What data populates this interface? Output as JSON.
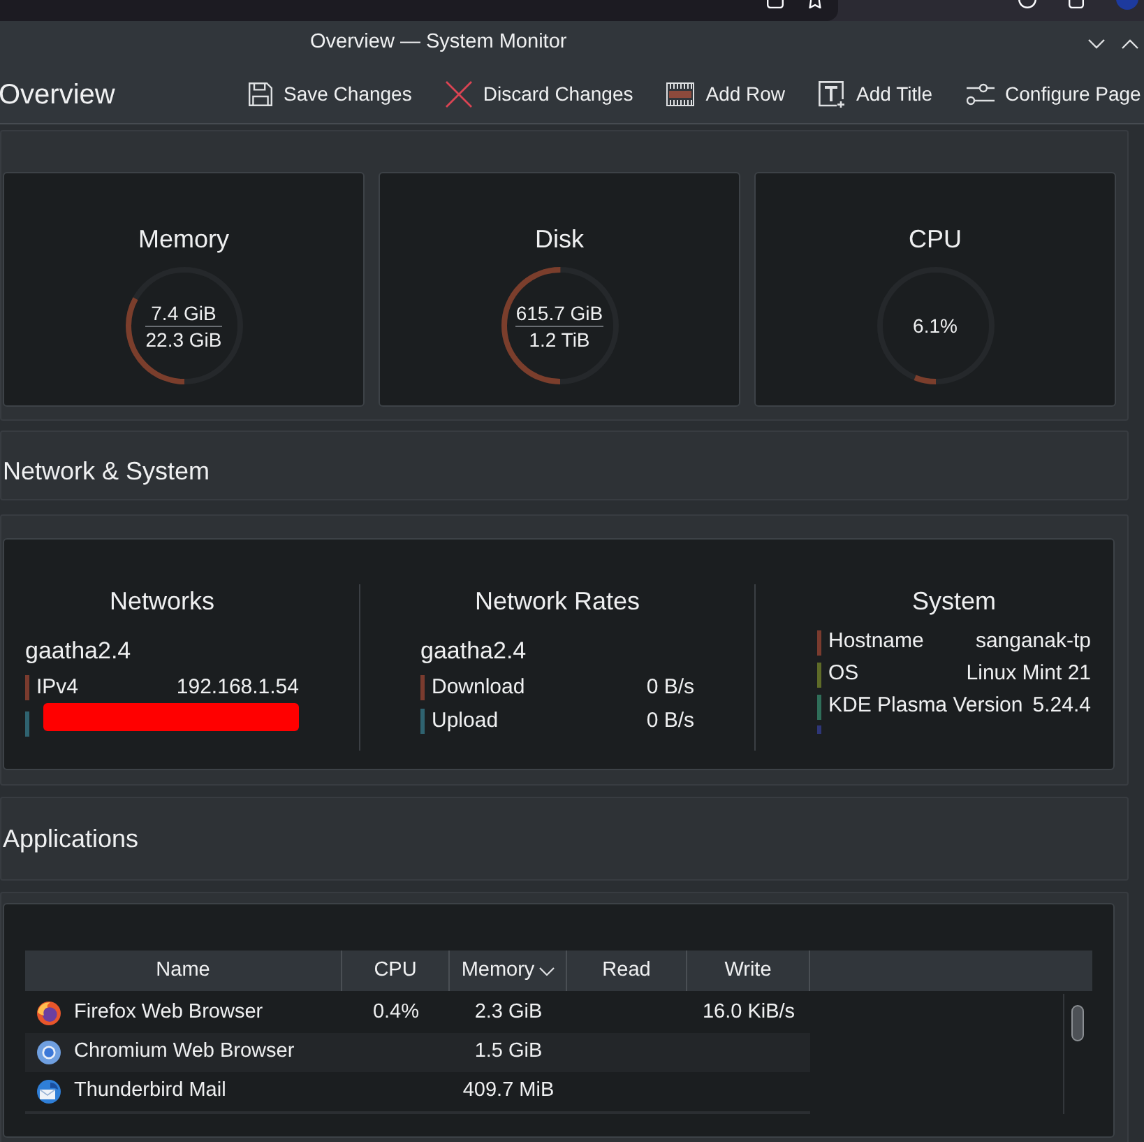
{
  "window": {
    "title": "Overview — System Monitor"
  },
  "page": {
    "title": "Overview"
  },
  "toolbar": [
    {
      "kind": "save",
      "label": "Save Changes"
    },
    {
      "kind": "discard",
      "label": "Discard Changes"
    },
    {
      "kind": "add_row",
      "label": "Add Row"
    },
    {
      "kind": "add_title",
      "label": "Add Title"
    },
    {
      "kind": "configure",
      "label": "Configure Page"
    }
  ],
  "gauges": [
    {
      "kind": "ratio",
      "title": "Memory",
      "used": "7.4 GiB",
      "total": "22.3 GiB",
      "level": 0.33
    },
    {
      "kind": "ratio",
      "title": "Disk",
      "used": "615.7 GiB",
      "total": "1.2 TiB",
      "level": 0.5
    },
    {
      "kind": "single",
      "title": "CPU",
      "value": "6.1%",
      "level": 0.061
    }
  ],
  "network_section": {
    "title": "Network & System",
    "panels": [
      {
        "title": "Networks",
        "interface": "gaatha2.4",
        "rows": [
          {
            "kind": "pair",
            "label": "IPv4",
            "value": "192.168.1.54",
            "color": "#7a3b2e"
          },
          {
            "kind": "redacted",
            "color": "#2f6370"
          }
        ]
      },
      {
        "title": "Network Rates",
        "interface": "gaatha2.4",
        "rows": [
          {
            "kind": "pair",
            "label": "Download",
            "value": "0 B/s",
            "color": "#7a3b2e"
          },
          {
            "kind": "pair",
            "label": "Upload",
            "value": "0 B/s",
            "color": "#2f6370"
          }
        ]
      },
      {
        "title": "System",
        "rows": [
          {
            "kind": "pair",
            "label": "Hostname",
            "value": "sanganak-tp",
            "color": "#7a3b2e"
          },
          {
            "kind": "pair",
            "label": "OS",
            "value": "Linux Mint 21",
            "color": "#5e6b28"
          },
          {
            "kind": "pair",
            "label": "KDE Plasma Version",
            "value": "5.24.4",
            "color": "#2f6e59"
          },
          {
            "kind": "clipped",
            "color": "#2e3678"
          }
        ]
      }
    ]
  },
  "applications_section": {
    "title": "Applications",
    "table": {
      "columns": [
        {
          "label": "Name",
          "sorted": false
        },
        {
          "label": "CPU",
          "sorted": false
        },
        {
          "label": "Memory",
          "sorted": true
        },
        {
          "label": "Read",
          "sorted": false
        },
        {
          "label": "Write",
          "sorted": false
        }
      ],
      "rows": [
        {
          "kind": "flame_globe",
          "name": "Firefox Web Browser",
          "cpu": "0.4%",
          "memory": "2.3 GiB",
          "write": "16.0 KiB/s"
        },
        {
          "kind": "ring",
          "name": "Chromium Web Browser",
          "memory": "1.5 GiB"
        },
        {
          "kind": "bird",
          "name": "Thunderbird Mail",
          "memory": "409.7 MiB"
        }
      ]
    }
  }
}
